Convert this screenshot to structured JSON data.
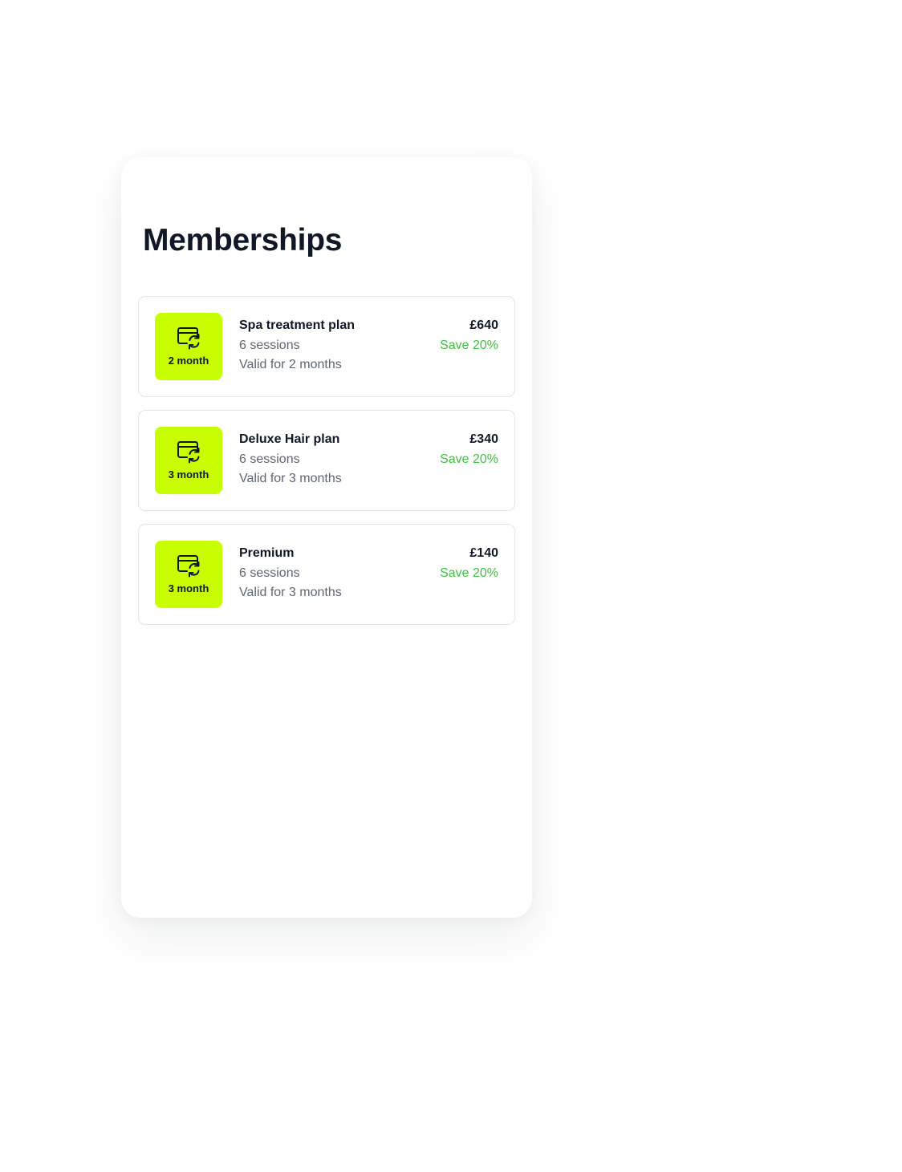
{
  "page": {
    "title": "Memberships"
  },
  "colors": {
    "accent": "#c8ff00",
    "save_text": "#3fc23f",
    "heading": "#101828",
    "muted": "#5f6573",
    "card_border": "#e3e5ea"
  },
  "memberships": [
    {
      "icon": "card-refresh-icon",
      "badge": "2 month",
      "name": "Spa treatment plan",
      "sessions": "6 sessions",
      "validity": "Valid for 2 months",
      "price": "£640",
      "discount": "Save 20%"
    },
    {
      "icon": "card-refresh-icon",
      "badge": "3 month",
      "name": "Deluxe Hair plan",
      "sessions": "6 sessions",
      "validity": "Valid for 3 months",
      "price": "£340",
      "discount": "Save 20%"
    },
    {
      "icon": "card-refresh-icon",
      "badge": "3 month",
      "name": "Premium",
      "sessions": "6 sessions",
      "validity": "Valid for 3 months",
      "price": "£140",
      "discount": "Save 20%"
    }
  ]
}
